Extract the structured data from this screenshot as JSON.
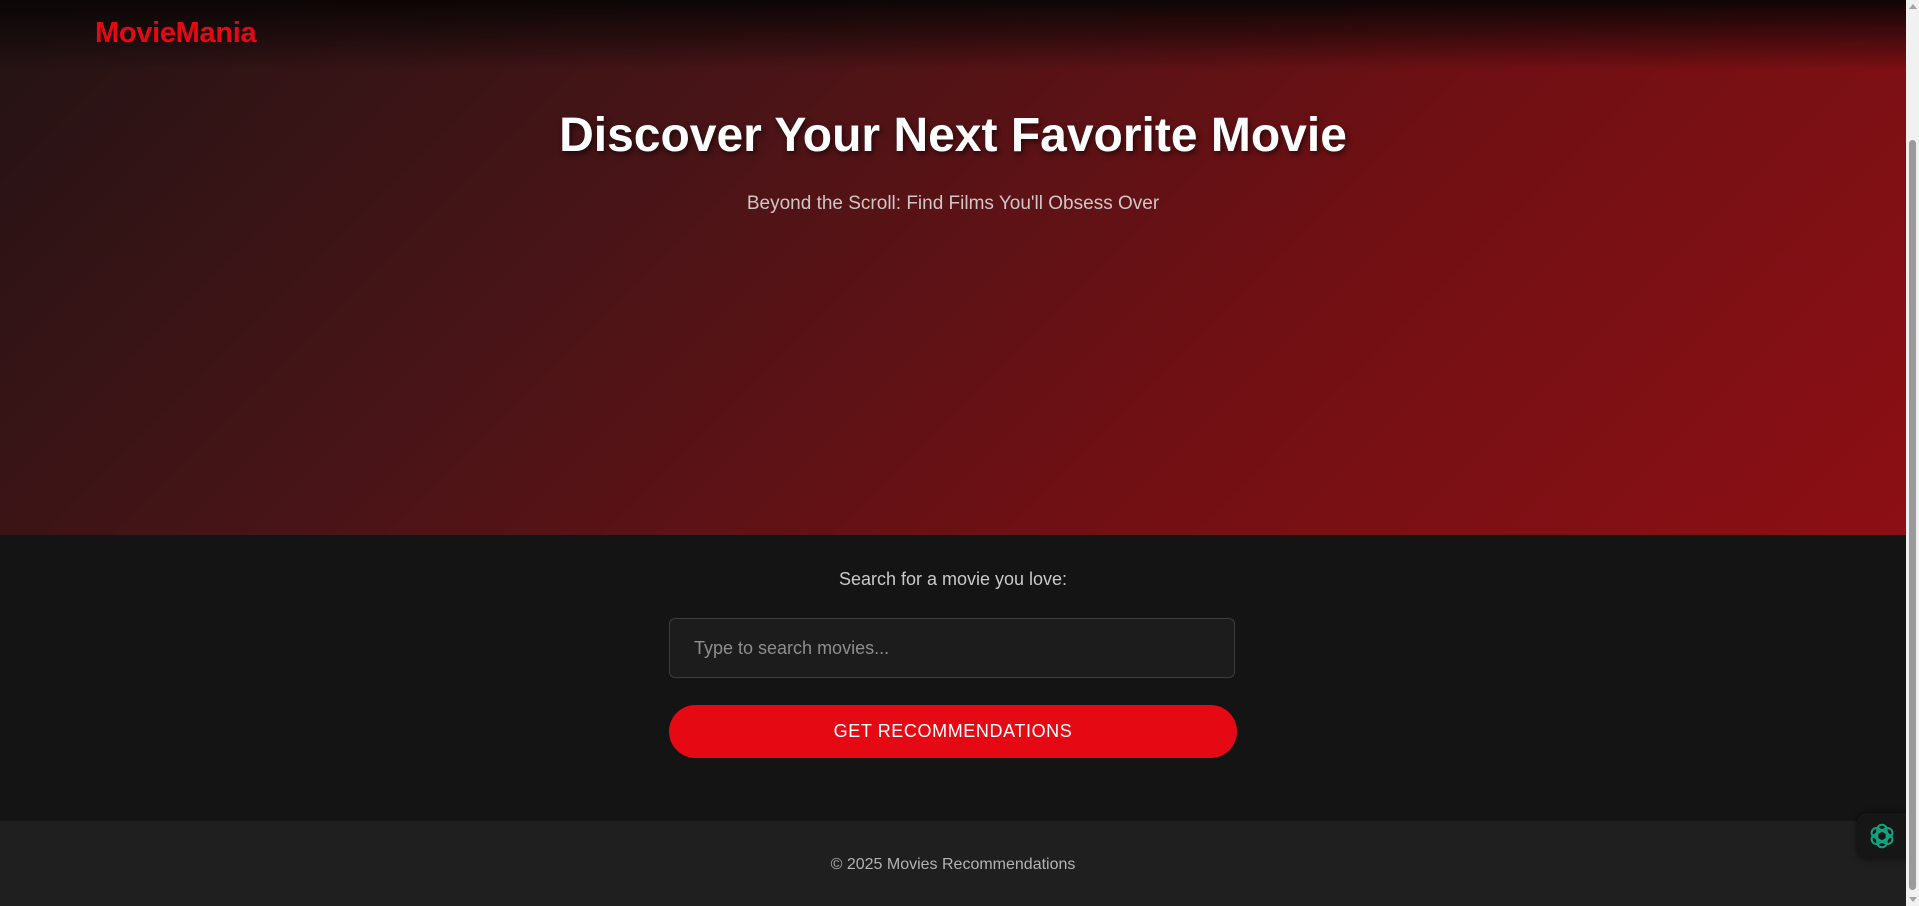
{
  "header": {
    "logo_text": "MovieMania"
  },
  "hero": {
    "title": "Discover Your Next Favorite Movie",
    "subtitle": "Beyond the Scroll: Find Films You'll Obsess Over"
  },
  "search": {
    "label": "Search for a movie you love:",
    "placeholder": "Type to search movies...",
    "value": "",
    "button_label": "GET RECOMMENDATIONS"
  },
  "footer": {
    "copyright": "© 2025 Movies Recommendations"
  },
  "assistant": {
    "icon": "openai-assistant-icon",
    "icon_color": "#10a37f"
  },
  "colors": {
    "brand_red": "#e50914",
    "background_dark": "#141414",
    "footer_bg": "#1f1f1f"
  }
}
